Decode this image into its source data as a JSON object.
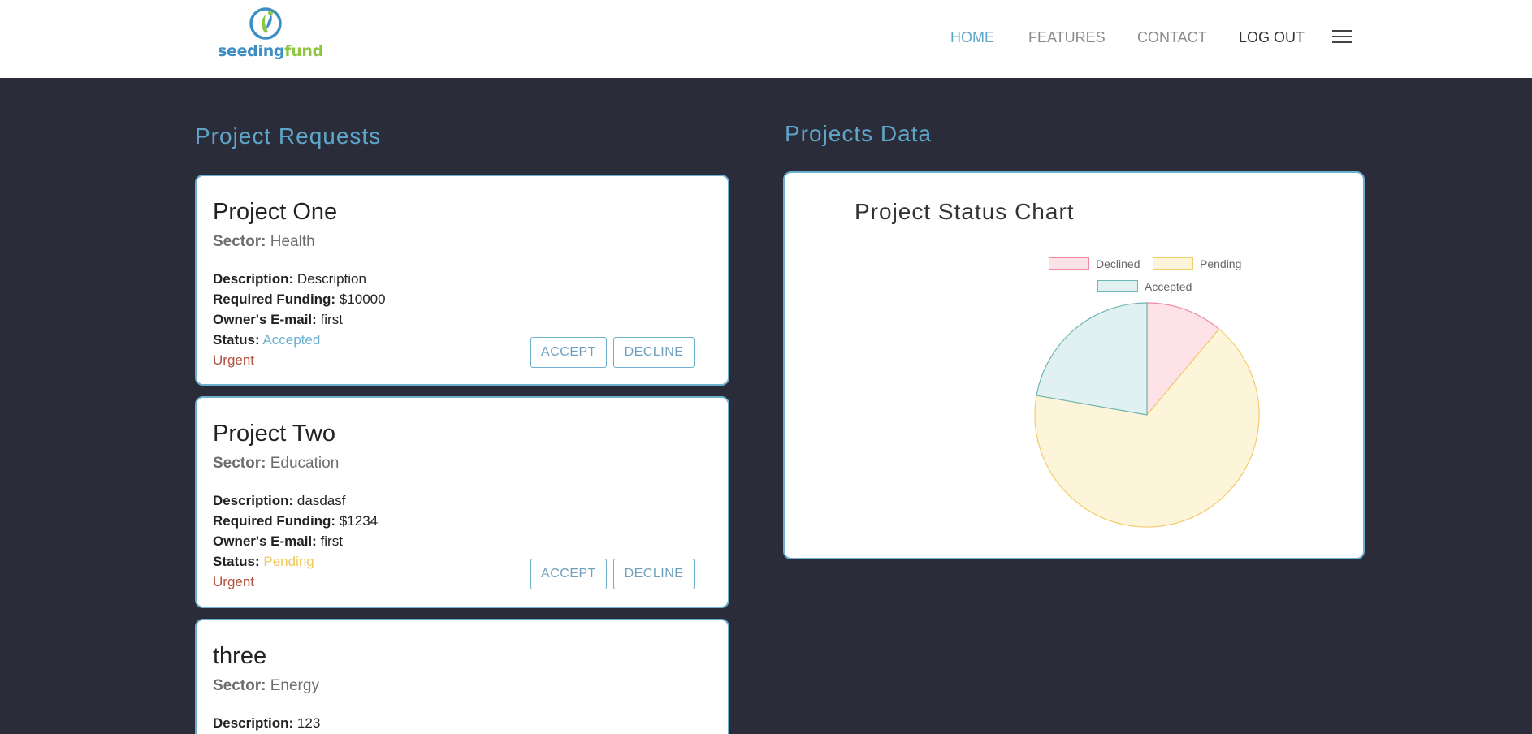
{
  "brand": {
    "name_part1": "seeding",
    "name_part2": "fund"
  },
  "nav": {
    "home": "HOME",
    "features": "FEATURES",
    "contact": "CONTACT",
    "logout": "LOG OUT"
  },
  "sections": {
    "requests_title": "Project Requests",
    "data_title": "Projects Data"
  },
  "labels": {
    "sector": "Sector:",
    "description": "Description:",
    "required_funding": "Required Funding:",
    "owner_email": "Owner's E-mail:",
    "status": "Status:",
    "accept": "ACCEPT",
    "decline": "DECLINE"
  },
  "projects": [
    {
      "title": "Project One",
      "sector": "Health",
      "description": "Description",
      "funding": "$10000",
      "email": "first",
      "status": "Accepted",
      "urgency": "Urgent"
    },
    {
      "title": "Project Two",
      "sector": "Education",
      "description": "dasdasf",
      "funding": "$1234",
      "email": "first",
      "status": "Pending",
      "urgency": "Urgent"
    },
    {
      "title": "three",
      "sector": "Energy",
      "description": "123"
    }
  ],
  "chart_data": {
    "type": "pie",
    "title": "Project Status Chart",
    "categories": [
      "Declined",
      "Pending",
      "Accepted"
    ],
    "values": [
      1,
      6,
      2
    ],
    "colors": {
      "Declined": {
        "fill": "#fde3e7",
        "stroke": "#f08a9e"
      },
      "Pending": {
        "fill": "#fdf5da",
        "stroke": "#f2cc6b"
      },
      "Accepted": {
        "fill": "#e1f1f1",
        "stroke": "#6fb5b5"
      }
    },
    "legend": "top"
  }
}
